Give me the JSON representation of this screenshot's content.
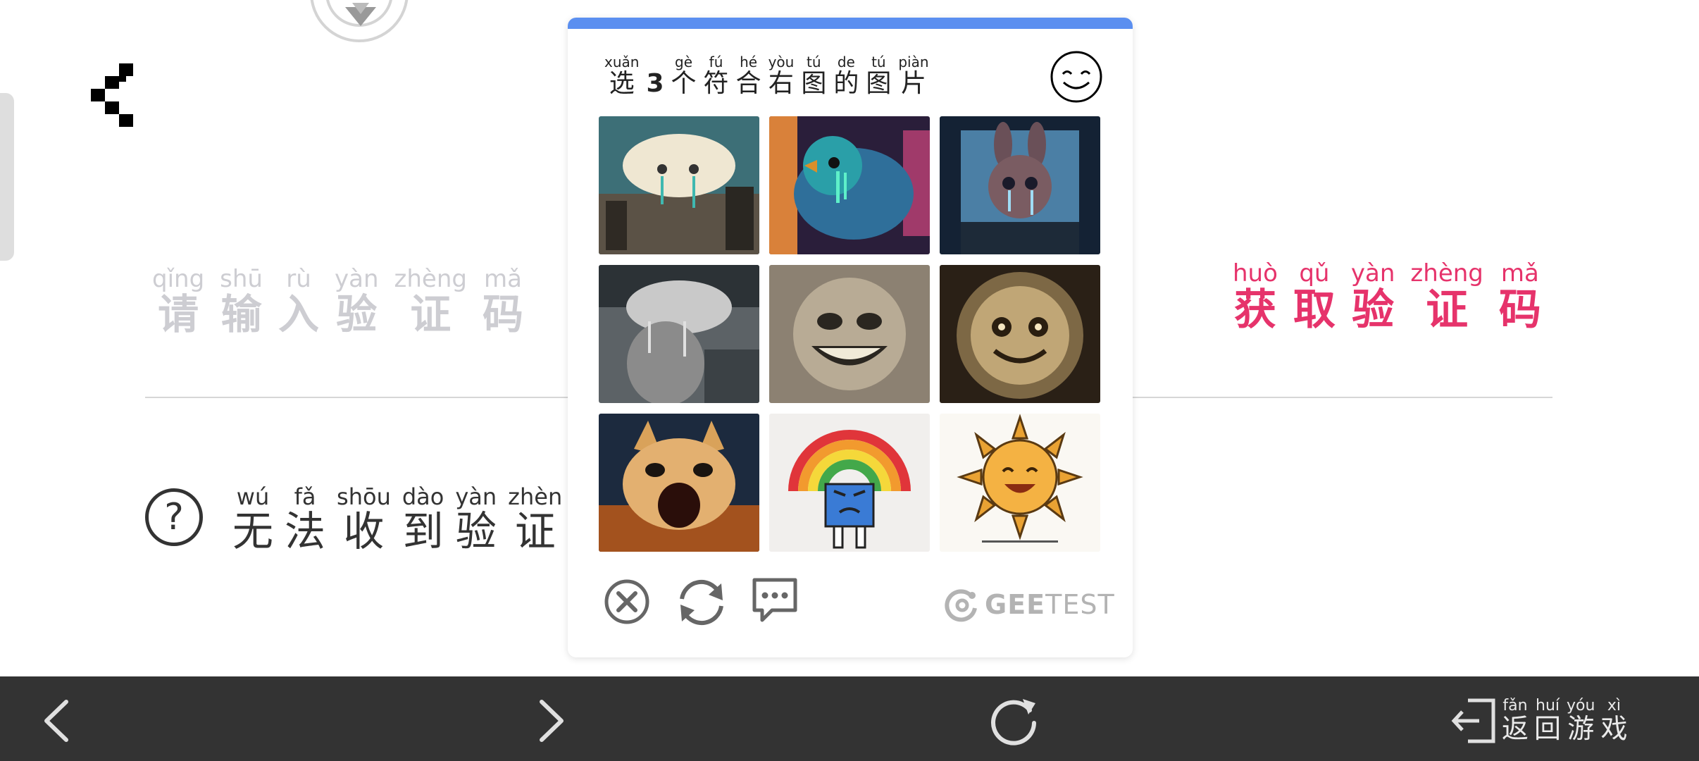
{
  "page": {
    "input_label": [
      {
        "pinyin": "qǐng",
        "char": "请"
      },
      {
        "pinyin": "shū",
        "char": "输"
      },
      {
        "pinyin": "rù",
        "char": "入"
      },
      {
        "pinyin": "yàn",
        "char": "验"
      },
      {
        "pinyin": "zhèng",
        "char": "证"
      },
      {
        "pinyin": "mǎ",
        "char": "码"
      }
    ],
    "get_code": [
      {
        "pinyin": "huò",
        "char": "获"
      },
      {
        "pinyin": "qǔ",
        "char": "取"
      },
      {
        "pinyin": "yàn",
        "char": "验"
      },
      {
        "pinyin": "zhèng",
        "char": "证"
      },
      {
        "pinyin": "mǎ",
        "char": "码"
      }
    ],
    "no_code": [
      {
        "pinyin": "wú",
        "char": "无"
      },
      {
        "pinyin": "fǎ",
        "char": "法"
      },
      {
        "pinyin": "shōu",
        "char": "收"
      },
      {
        "pinyin": "dào",
        "char": "到"
      },
      {
        "pinyin": "yàn",
        "char": "验"
      },
      {
        "pinyin": "zhèn",
        "char": "证"
      }
    ],
    "help_icon": "question-circle-icon",
    "back_icon": "pixel-chevron-left-icon",
    "accent_color": "#e6336b"
  },
  "captcha": {
    "prompt": [
      {
        "pinyin": "xuǎn",
        "char": "选"
      },
      {
        "pinyin": "",
        "char": "3",
        "numeric": true
      },
      {
        "pinyin": "gè",
        "char": "个"
      },
      {
        "pinyin": "fú",
        "char": "符"
      },
      {
        "pinyin": "hé",
        "char": "合"
      },
      {
        "pinyin": "yòu",
        "char": "右"
      },
      {
        "pinyin": "tú",
        "char": "图"
      },
      {
        "pinyin": "de",
        "char": "的"
      },
      {
        "pinyin": "tú",
        "char": "图"
      },
      {
        "pinyin": "piàn",
        "char": "片"
      }
    ],
    "reference_icon": "smiley-face-icon",
    "tiles": [
      "crying-cloud-over-city",
      "crying-blue-bird-neon",
      "crying-bunny-dark-forest",
      "crying-cloud-statue",
      "smiling-silver-face",
      "smiling-golden-blob",
      "screaming-cat-sunset",
      "grumpy-rainbow-character",
      "smiling-sun"
    ],
    "footer": {
      "close_icon": "close-circle-icon",
      "refresh_icon": "refresh-icon",
      "feedback_icon": "feedback-chat-icon",
      "brand_bold": "GEE",
      "brand_light": "TEST"
    },
    "header_color": "#5b8ff0"
  },
  "navbar": {
    "prev_icon": "chevron-left-icon",
    "next_icon": "chevron-right-icon",
    "reload_icon": "reload-icon",
    "exit_icon": "exit-icon",
    "exit_label": [
      {
        "pinyin": "fǎn",
        "char": "返"
      },
      {
        "pinyin": "huí",
        "char": "回"
      },
      {
        "pinyin": "yóu",
        "char": "游"
      },
      {
        "pinyin": "xì",
        "char": "戏"
      }
    ]
  }
}
